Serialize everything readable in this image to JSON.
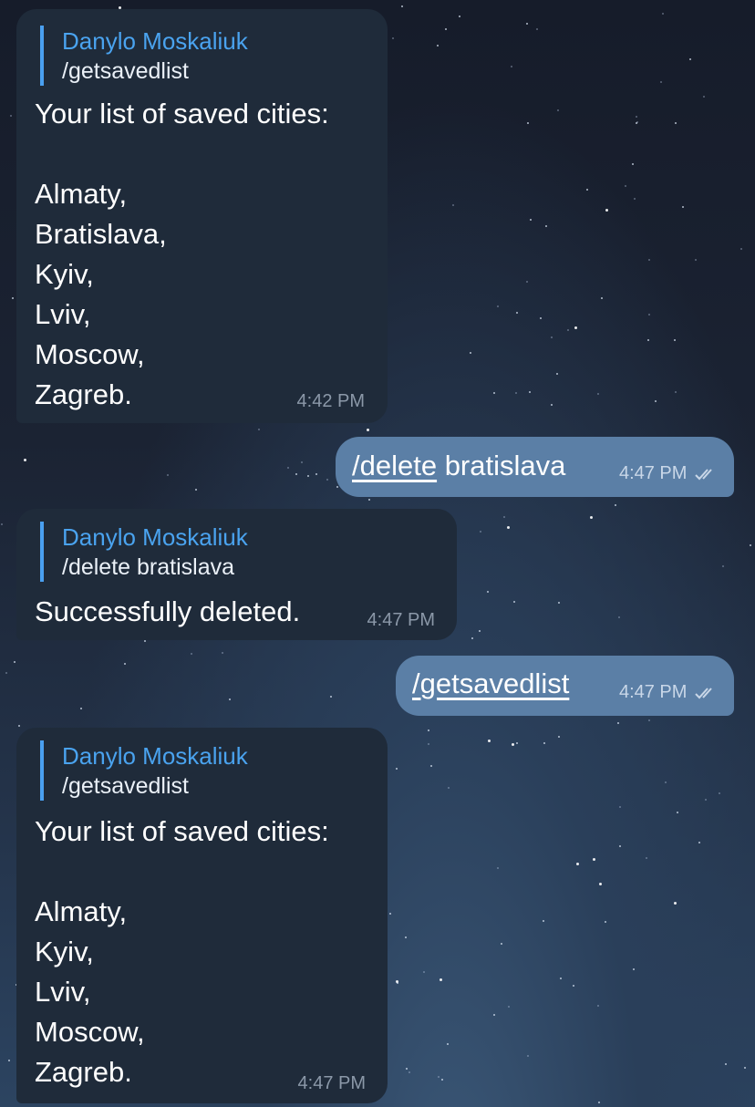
{
  "chat": {
    "messages": [
      {
        "direction": "incoming",
        "reply_to_name": "Danylo Moskaliuk",
        "reply_to_text": "/getsavedlist",
        "text": "Your list of saved cities:\n\nAlmaty,\nBratislava,\nKyiv,\nLviv,\nMoscow,\nZagreb.",
        "time": "4:42 PM"
      },
      {
        "direction": "outgoing",
        "command": "/delete",
        "text": " bratislava",
        "time": "4:47 PM",
        "status": "read-double-check-icon"
      },
      {
        "direction": "incoming",
        "reply_to_name": "Danylo Moskaliuk",
        "reply_to_text": "/delete bratislava",
        "text": "Successfully deleted.",
        "time": "4:47 PM"
      },
      {
        "direction": "outgoing",
        "command": "/getsavedlist",
        "text": "",
        "time": "4:47 PM",
        "status": "read-double-check-icon"
      },
      {
        "direction": "incoming",
        "reply_to_name": "Danylo Moskaliuk",
        "reply_to_text": "/getsavedlist",
        "text": "Your list of saved cities:\n\nAlmaty,\nKyiv,\nLviv,\nMoscow,\nZagreb.",
        "time": "4:47 PM"
      }
    ]
  },
  "colors": {
    "incoming_bubble": "#1f2b3a",
    "outgoing_bubble": "#5b7fa6",
    "reply_accent": "#4aa0f0",
    "background_top": "#161c2a",
    "background_bottom": "#2c4461"
  }
}
